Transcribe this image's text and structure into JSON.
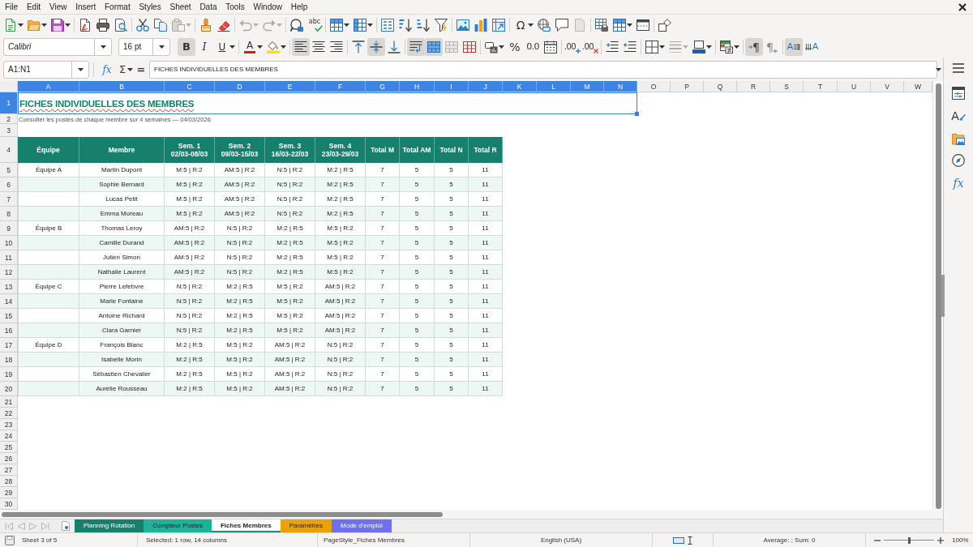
{
  "menu_bar": {
    "items": [
      "File",
      "Edit",
      "View",
      "Insert",
      "Format",
      "Styles",
      "Sheet",
      "Data",
      "Tools",
      "Window",
      "Help"
    ]
  },
  "standard_toolbar": {
    "spelling_glyph": "abc",
    "special_character_glyph": "Ω"
  },
  "formatting_toolbar": {
    "font_name": "Calibri",
    "font_size": "16 pt",
    "bold": {
      "glyph": "B",
      "on": true
    },
    "italic": {
      "glyph": "I",
      "on": false
    },
    "underline": {
      "glyph": "U",
      "on": false
    },
    "font_color_glyph": "A",
    "align_left": true,
    "align_center": false,
    "align_right": false,
    "align_top": false,
    "align_middle": true,
    "align_bottom": false,
    "wrap_text": true,
    "merge_and_center": true,
    "merge_cells": false,
    "unmerge_cells": false,
    "percent_glyph": "%",
    "number_glyph": "0.0",
    "add_decimal_glyph": ".00",
    "delete_decimal_glyph": ".00",
    "left_to_right": {
      "glyph": "¶",
      "on": true
    },
    "right_to_left": {
      "glyph": "¶",
      "on": false
    },
    "text_left_to_right": {
      "glyph": "A",
      "on": true
    },
    "text_top_to_bottom": {
      "glyph": "A",
      "on": false
    }
  },
  "formula_bar": {
    "name_box": "A1:N1",
    "function_wizard_glyph": "fx",
    "sum_glyph": "Σ",
    "formula_glyph": "=",
    "content": "FICHES INDIVIDUELLES DES MEMBRES"
  },
  "sidebar": {
    "styles_glyph": "A",
    "functions_glyph": "fx"
  },
  "column_headers": [
    {
      "label": "A",
      "selected": true
    },
    {
      "label": "B",
      "selected": true
    },
    {
      "label": "C",
      "selected": true
    },
    {
      "label": "D",
      "selected": true
    },
    {
      "label": "E",
      "selected": true
    },
    {
      "label": "F",
      "selected": true
    },
    {
      "label": "G",
      "selected": true
    },
    {
      "label": "H",
      "selected": true
    },
    {
      "label": "I",
      "selected": true
    },
    {
      "label": "J",
      "selected": true
    },
    {
      "label": "K",
      "selected": true
    },
    {
      "label": "L",
      "selected": true
    },
    {
      "label": "M",
      "selected": true
    },
    {
      "label": "N",
      "selected": true
    },
    {
      "label": "O",
      "selected": false
    },
    {
      "label": "P",
      "selected": false
    },
    {
      "label": "Q",
      "selected": false
    },
    {
      "label": "R",
      "selected": false
    },
    {
      "label": "S",
      "selected": false
    },
    {
      "label": "T",
      "selected": false
    },
    {
      "label": "U",
      "selected": false
    },
    {
      "label": "V",
      "selected": false
    },
    {
      "label": "W",
      "selected": false
    }
  ],
  "row_headers": [
    {
      "label": "1",
      "selected": true
    },
    {
      "label": "2",
      "selected": false
    },
    {
      "label": "3",
      "selected": false
    },
    {
      "label": "4",
      "selected": false
    },
    {
      "label": "5",
      "selected": false
    },
    {
      "label": "6",
      "selected": false
    },
    {
      "label": "7",
      "selected": false
    },
    {
      "label": "8",
      "selected": false
    },
    {
      "label": "9",
      "selected": false
    },
    {
      "label": "10",
      "selected": false
    },
    {
      "label": "11",
      "selected": false
    },
    {
      "label": "12",
      "selected": false
    },
    {
      "label": "13",
      "selected": false
    },
    {
      "label": "14",
      "selected": false
    },
    {
      "label": "15",
      "selected": false
    },
    {
      "label": "16",
      "selected": false
    },
    {
      "label": "17",
      "selected": false
    },
    {
      "label": "18",
      "selected": false
    },
    {
      "label": "19",
      "selected": false
    },
    {
      "label": "20",
      "selected": false
    },
    {
      "label": "21",
      "selected": false
    },
    {
      "label": "22",
      "selected": false
    },
    {
      "label": "23",
      "selected": false
    },
    {
      "label": "24",
      "selected": false
    },
    {
      "label": "25",
      "selected": false
    },
    {
      "label": "26",
      "selected": false
    },
    {
      "label": "27",
      "selected": false
    },
    {
      "label": "28",
      "selected": false
    },
    {
      "label": "29",
      "selected": false
    },
    {
      "label": "30",
      "selected": false
    }
  ],
  "sheet": {
    "title": "FICHES INDIVIDUELLES DES MEMBRES",
    "subtitle": "Consulter les postes de chaque membre sur 4 semaines — 04/03/2026",
    "table": {
      "columns": [
        {
          "label": "Équipe"
        },
        {
          "label": "Membre"
        },
        {
          "label": "Sem. 1",
          "dates": "02/03-08/03"
        },
        {
          "label": "Sem. 2",
          "dates": "09/03-15/03"
        },
        {
          "label": "Sem. 3",
          "dates": "16/03-22/03"
        },
        {
          "label": "Sem. 4",
          "dates": "23/03-29/03"
        },
        {
          "label": "Total M"
        },
        {
          "label": "Total AM"
        },
        {
          "label": "Total N"
        },
        {
          "label": "Total R"
        }
      ],
      "rows": [
        {
          "team": "Équipe A",
          "member": "Martin Dupont",
          "weeks": [
            "M:5 | R:2",
            "AM:5 | R:2",
            "N:5 | R:2",
            "M:2 | R:5"
          ],
          "totals": [
            "7",
            "5",
            "5",
            "11"
          ]
        },
        {
          "member": "Sophie Bernard",
          "weeks": [
            "M:5 | R:2",
            "AM:5 | R:2",
            "N:5 | R:2",
            "M:2 | R:5"
          ],
          "totals": [
            "7",
            "5",
            "5",
            "11"
          ]
        },
        {
          "member": "Lucas Petit",
          "weeks": [
            "M:5 | R:2",
            "AM:5 | R:2",
            "N:5 | R:2",
            "M:2 | R:5"
          ],
          "totals": [
            "7",
            "5",
            "5",
            "11"
          ]
        },
        {
          "member": "Emma Moreau",
          "weeks": [
            "M:5 | R:2",
            "AM:5 | R:2",
            "N:5 | R:2",
            "M:2 | R:5"
          ],
          "totals": [
            "7",
            "5",
            "5",
            "11"
          ]
        },
        {
          "team": "Équipe B",
          "member": "Thomas Leroy",
          "weeks": [
            "AM:5 | R:2",
            "N:5 | R:2",
            "M:2 | R:5",
            "M:5 | R:2"
          ],
          "totals": [
            "7",
            "5",
            "5",
            "11"
          ]
        },
        {
          "member": "Camille Durand",
          "weeks": [
            "AM:5 | R:2",
            "N:5 | R:2",
            "M:2 | R:5",
            "M:5 | R:2"
          ],
          "totals": [
            "7",
            "5",
            "5",
            "11"
          ]
        },
        {
          "member": "Julien Simon",
          "weeks": [
            "AM:5 | R:2",
            "N:5 | R:2",
            "M:2 | R:5",
            "M:5 | R:2"
          ],
          "totals": [
            "7",
            "5",
            "5",
            "11"
          ]
        },
        {
          "member": "Nathalie Laurent",
          "weeks": [
            "AM:5 | R:2",
            "N:5 | R:2",
            "M:2 | R:5",
            "M:5 | R:2"
          ],
          "totals": [
            "7",
            "5",
            "5",
            "11"
          ]
        },
        {
          "team": "Équipe C",
          "member": "Pierre Lefebvre",
          "weeks": [
            "N:5 | R:2",
            "M:2 | R:5",
            "M:5 | R:2",
            "AM:5 | R:2"
          ],
          "totals": [
            "7",
            "5",
            "5",
            "11"
          ]
        },
        {
          "member": "Marie Fontaine",
          "weeks": [
            "N:5 | R:2",
            "M:2 | R:5",
            "M:5 | R:2",
            "AM:5 | R:2"
          ],
          "totals": [
            "7",
            "5",
            "5",
            "11"
          ]
        },
        {
          "member": "Antoine Richard",
          "weeks": [
            "N:5 | R:2",
            "M:2 | R:5",
            "M:5 | R:2",
            "AM:5 | R:2"
          ],
          "totals": [
            "7",
            "5",
            "5",
            "11"
          ]
        },
        {
          "member": "Clara Garnier",
          "weeks": [
            "N:5 | R:2",
            "M:2 | R:5",
            "M:5 | R:2",
            "AM:5 | R:2"
          ],
          "totals": [
            "7",
            "5",
            "5",
            "11"
          ]
        },
        {
          "team": "Équipe D",
          "member": "François Blanc",
          "weeks": [
            "M:2 | R:5",
            "M:5 | R:2",
            "AM:5 | R:2",
            "N:5 | R:2"
          ],
          "totals": [
            "7",
            "5",
            "5",
            "11"
          ]
        },
        {
          "member": "Isabelle Morin",
          "weeks": [
            "M:2 | R:5",
            "M:5 | R:2",
            "AM:5 | R:2",
            "N:5 | R:2"
          ],
          "totals": [
            "7",
            "5",
            "5",
            "11"
          ]
        },
        {
          "member": "Sébastien Chevalier",
          "weeks": [
            "M:2 | R:5",
            "M:5 | R:2",
            "AM:5 | R:2",
            "N:5 | R:2"
          ],
          "totals": [
            "7",
            "5",
            "5",
            "11"
          ]
        },
        {
          "member": "Aurélie Rousseau",
          "weeks": [
            "M:2 | R:5",
            "M:5 | R:2",
            "AM:5 | R:2",
            "N:5 | R:2"
          ],
          "totals": [
            "7",
            "5",
            "5",
            "11"
          ]
        }
      ]
    }
  },
  "sheet_tabs": [
    {
      "label": "Planning Rotation",
      "color": "#17806d",
      "selected": false
    },
    {
      "label": "Compteur Postes",
      "color": "#1db39b",
      "selected": false
    },
    {
      "label": "Fiches Membres",
      "color": "#1f8f73",
      "selected": true
    },
    {
      "label": "Paramètres",
      "color": "#e8a300",
      "selected": false
    },
    {
      "label": "Mode d'emploi",
      "color": "#6f6ff2",
      "selected": false
    }
  ],
  "status_bar": {
    "sheet": "Sheet 3 of 5",
    "selection": "Selected: 1 row, 14 columns",
    "page_style": "PageStyle_Fiches Membres",
    "language": "English (USA)",
    "summary": "Average: ; Sum: 0",
    "zoom": {
      "level": 0.5
    },
    "zoom_percent": "100%"
  }
}
